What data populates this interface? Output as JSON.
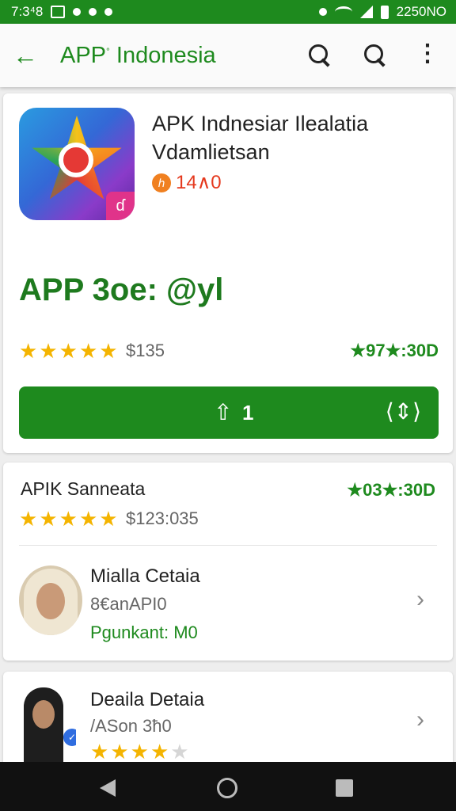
{
  "status_bar": {
    "time": "7:3⁴8",
    "right_text": "2250NO"
  },
  "app_bar": {
    "title_prefix": "APP",
    "title_rest": " Indonesia"
  },
  "app": {
    "name": "APK Indnesiar Ilealatia Vdamlietsan",
    "size": "14∧0",
    "size_icon_glyph": "ℎ",
    "big_title": "APP 3oe: @yl",
    "rating_stars": 4.5,
    "rating_count": "$135",
    "score": "★97★:30D",
    "install": {
      "icon_glyph": "⇧",
      "label": "1",
      "arrows_glyph": "⟨⇕⟩"
    }
  },
  "section": {
    "title": "APIK Sanneata",
    "score": "★03★:30D",
    "rating_stars": 4.5,
    "rating_count": "$123:035"
  },
  "reviews": [
    {
      "name": "Mialla Cetaia",
      "sub": "8€anAPI0",
      "tag": "Pgunkant: M0"
    },
    {
      "name": "Deaila Detaia",
      "sub": "/ASon 3ħ0",
      "rating_stars": 3.5
    }
  ],
  "colors": {
    "primary_green": "#1e8a1e",
    "star_yellow": "#f4b400",
    "size_red": "#e5391e"
  },
  "icons": {
    "back": "arrow-left-icon",
    "search": "search-icon",
    "more": "more-vertical-icon",
    "chevron": "chevron-right-icon"
  }
}
